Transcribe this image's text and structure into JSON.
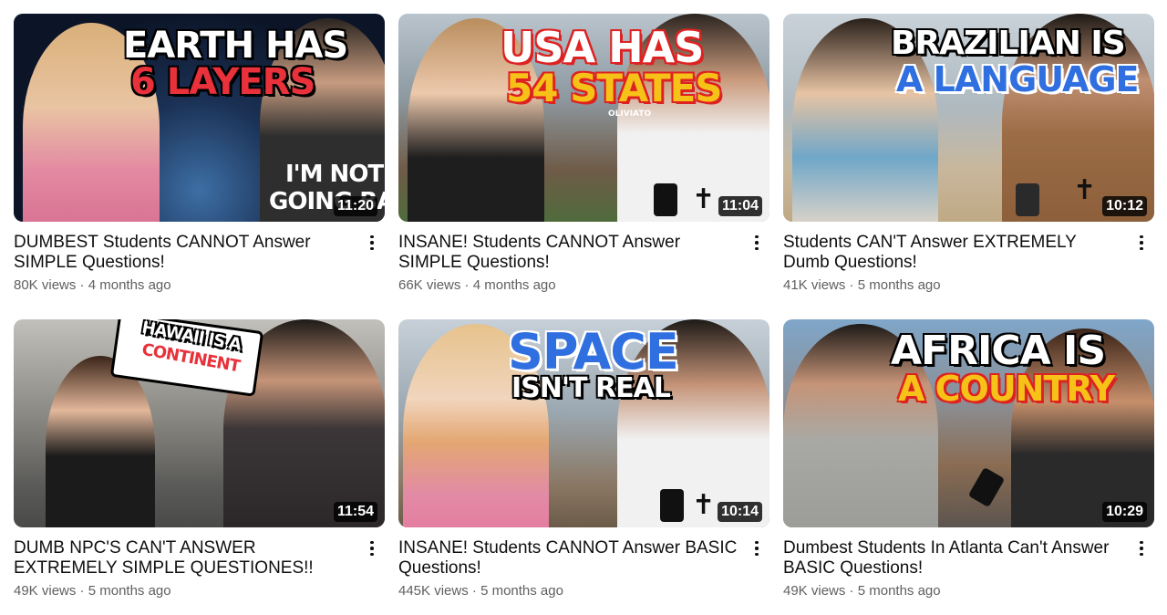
{
  "videos": [
    {
      "title": "DUMBEST Students CANNOT Answer SIMPLE Questions!",
      "views": "80K views",
      "age": "4 months ago",
      "duration": "11:20",
      "overlay": [
        "EARTH HAS",
        "6 LAYERS"
      ],
      "shirt": [
        "I'M NOT",
        "GOING BAD"
      ],
      "colors": {
        "bg": "#1d2b4a",
        "accent": "#e8313a"
      }
    },
    {
      "title": "INSANE! Students CANNOT Answer SIMPLE Questions!",
      "views": "66K views",
      "age": "4 months ago",
      "duration": "11:04",
      "overlay": [
        "USA HAS",
        "54 STATES"
      ],
      "sign": "OLIVIATO",
      "colors": {
        "bg": "#7c8a94",
        "accent": "#f7c218"
      }
    },
    {
      "title": "Students CAN'T Answer EXTREMELY Dumb Questions!",
      "views": "41K views",
      "age": "5 months ago",
      "duration": "10:12",
      "overlay": [
        "BRAZILIAN IS",
        "A LANGUAGE"
      ],
      "colors": {
        "bg": "#a9b6bf",
        "accent": "#2f6fe0"
      }
    },
    {
      "title": "DUMB NPC'S CAN'T ANSWER EXTREMELY SIMPLE QUESTIONES!!",
      "views": "49K views",
      "age": "5 months ago",
      "duration": "11:54",
      "overlay": [
        "HAWAII IS A",
        "CONTINENT"
      ],
      "colors": {
        "bg": "#8f8a82",
        "accent": "#e8313a"
      }
    },
    {
      "title": "INSANE! Students CANNOT Answer BASIC Questions!",
      "views": "445K views",
      "age": "5 months ago",
      "duration": "10:14",
      "overlay": [
        "SPACE",
        "ISN'T REAL"
      ],
      "colors": {
        "bg": "#9aa7b0",
        "accent": "#2f6fe0"
      }
    },
    {
      "title": "Dumbest Students In Atlanta Can't Answer BASIC Questions!",
      "views": "49K views",
      "age": "5 months ago",
      "duration": "10:29",
      "overlay": [
        "AFRICA IS",
        "A COUNTRY"
      ],
      "colors": {
        "bg": "#6e7b88",
        "accent": "#f7c218"
      }
    }
  ],
  "separator": "·"
}
